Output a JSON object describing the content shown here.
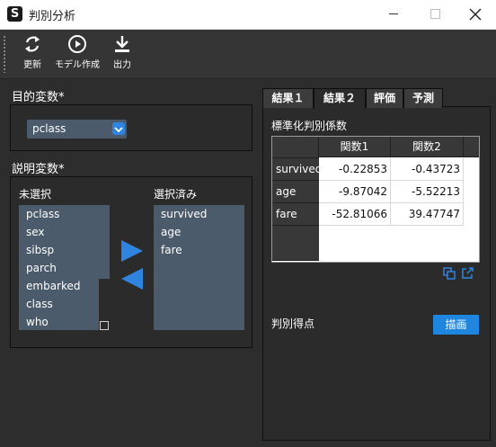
{
  "window": {
    "title": "判別分析",
    "app_icon_letter": "S"
  },
  "toolbar": {
    "buttons": [
      {
        "label": "更新",
        "icon": "refresh-icon"
      },
      {
        "label": "モデル作成",
        "icon": "play-circle-icon"
      },
      {
        "label": "出力",
        "icon": "download-icon"
      }
    ]
  },
  "target": {
    "label": "目的変数*",
    "selected": "pclass"
  },
  "explanatory": {
    "label": "説明変数*",
    "unselected_label": "未選択",
    "selected_label": "選択済み",
    "unselected": [
      "pclass",
      "sex",
      "sibsp",
      "parch",
      "embarked",
      "class",
      "who"
    ],
    "selected": [
      "survived",
      "age",
      "fare"
    ]
  },
  "tabs": [
    "結果１",
    "結果２",
    "評価",
    "予測"
  ],
  "active_tab": "結果２",
  "result": {
    "title": "標準化判別係数",
    "columns": [
      "関数1",
      "関数2"
    ],
    "rows": [
      {
        "name": "survived",
        "values": [
          "-0.22853",
          "-0.43723"
        ]
      },
      {
        "name": "age",
        "values": [
          "-9.87042",
          "-5.52213"
        ]
      },
      {
        "name": "fare",
        "values": [
          "-52.81066",
          "39.47747"
        ]
      }
    ],
    "score_label": "判別得点",
    "draw_button": "描画"
  },
  "colors": {
    "accent": "#1f86e0",
    "listbox": "#4b5b6c",
    "background": "#2d2d2d"
  }
}
